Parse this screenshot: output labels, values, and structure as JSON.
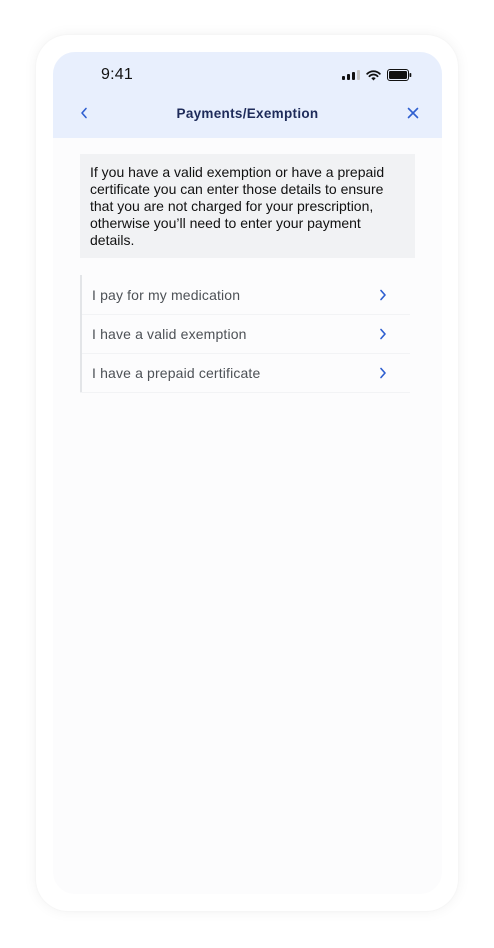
{
  "status_bar": {
    "time": "9:41",
    "icons": [
      "cellular-signal-icon",
      "wifi-icon",
      "battery-icon"
    ]
  },
  "nav": {
    "title": "Payments/Exemption",
    "back_icon": "chevron-left-icon",
    "close_icon": "close-icon"
  },
  "info": {
    "text": "If you have a valid exemption or have a prepaid certificate you can enter those details to ensure that you are not charged for your prescription, otherwise you’ll need to enter your payment details."
  },
  "options": [
    {
      "label": "I pay for my medication",
      "icon": "chevron-right-icon"
    },
    {
      "label": "I have a valid exemption",
      "icon": "chevron-right-icon"
    },
    {
      "label": "I have a prepaid certificate",
      "icon": "chevron-right-icon"
    }
  ],
  "colors": {
    "header_background": "#e8effd",
    "accent": "#2f5fd0",
    "title": "#1e2b5a",
    "info_background": "#f1f2f4"
  }
}
